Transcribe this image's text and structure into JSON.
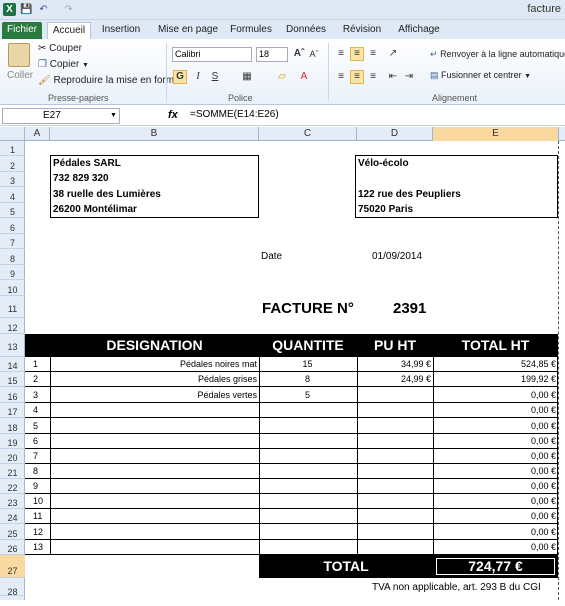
{
  "title_bar": {
    "doc_title": "facture"
  },
  "tabs": {
    "file": "Fichier",
    "home": "Accueil",
    "insert": "Insertion",
    "layout": "Mise en page",
    "formulas": "Formules",
    "data": "Données",
    "review": "Révision",
    "view": "Affichage"
  },
  "ribbon": {
    "paste": "Coller",
    "cut": "Couper",
    "copy": "Copier",
    "format_painter": "Reproduire la mise en forme",
    "clipboard_group": "Presse-papiers",
    "font_name": "Calibri",
    "font_size": "18",
    "bold": "G",
    "italic": "I",
    "underline": "S",
    "font_group": "Police",
    "wrap_text": "Renvoyer à la ligne automatique",
    "merge_center": "Fusionner et centrer",
    "alignment_group": "Alignement"
  },
  "formula_bar": {
    "name_box": "E27",
    "fx": "fx",
    "formula": "=SOMME(E14:E26)"
  },
  "columns": [
    "A",
    "B",
    "C",
    "D",
    "E"
  ],
  "rows": [
    "1",
    "2",
    "3",
    "4",
    "5",
    "6",
    "7",
    "8",
    "9",
    "10",
    "11",
    "12",
    "13",
    "14",
    "15",
    "16",
    "17",
    "18",
    "19",
    "20",
    "21",
    "22",
    "23",
    "24",
    "25",
    "26",
    "27",
    "28"
  ],
  "sender": {
    "name": "Pédales SARL",
    "phone": "732 829 320",
    "street": "38 ruelle des Lumières",
    "city": "26200 Montélimar"
  },
  "recipient": {
    "name": "Vélo-écolo",
    "street": "122 rue des Peupliers",
    "city": "75020 Paris"
  },
  "date": {
    "label": "Date",
    "value": "01/09/2014"
  },
  "invoice": {
    "label": "FACTURE N°",
    "number": "2391"
  },
  "table": {
    "headers": {
      "designation": "DESIGNATION",
      "quantity": "QUANTITE",
      "unit_price": "PU HT",
      "total": "TOTAL HT"
    },
    "lines": [
      {
        "n": "1",
        "designation": "Pédales noires mat",
        "quantity": "15",
        "unit_price": "34,99 €",
        "total": "524,85 €"
      },
      {
        "n": "2",
        "designation": "Pédales grises",
        "quantity": "8",
        "unit_price": "24,99 €",
        "total": "199,92 €"
      },
      {
        "n": "3",
        "designation": "Pédales vertes",
        "quantity": "5",
        "unit_price": "",
        "total": "0,00 €"
      },
      {
        "n": "4",
        "designation": "",
        "quantity": "",
        "unit_price": "",
        "total": "0,00 €"
      },
      {
        "n": "5",
        "designation": "",
        "quantity": "",
        "unit_price": "",
        "total": "0,00 €"
      },
      {
        "n": "6",
        "designation": "",
        "quantity": "",
        "unit_price": "",
        "total": "0,00 €"
      },
      {
        "n": "7",
        "designation": "",
        "quantity": "",
        "unit_price": "",
        "total": "0,00 €"
      },
      {
        "n": "8",
        "designation": "",
        "quantity": "",
        "unit_price": "",
        "total": "0,00 €"
      },
      {
        "n": "9",
        "designation": "",
        "quantity": "",
        "unit_price": "",
        "total": "0,00 €"
      },
      {
        "n": "10",
        "designation": "",
        "quantity": "",
        "unit_price": "",
        "total": "0,00 €"
      },
      {
        "n": "11",
        "designation": "",
        "quantity": "",
        "unit_price": "",
        "total": "0,00 €"
      },
      {
        "n": "12",
        "designation": "",
        "quantity": "",
        "unit_price": "",
        "total": "0,00 €"
      },
      {
        "n": "13",
        "designation": "",
        "quantity": "",
        "unit_price": "",
        "total": "0,00 €"
      }
    ],
    "total_label": "TOTAL",
    "total_value": "724,77 €"
  },
  "footnote": "TVA non applicable, art. 293 B du CGI"
}
